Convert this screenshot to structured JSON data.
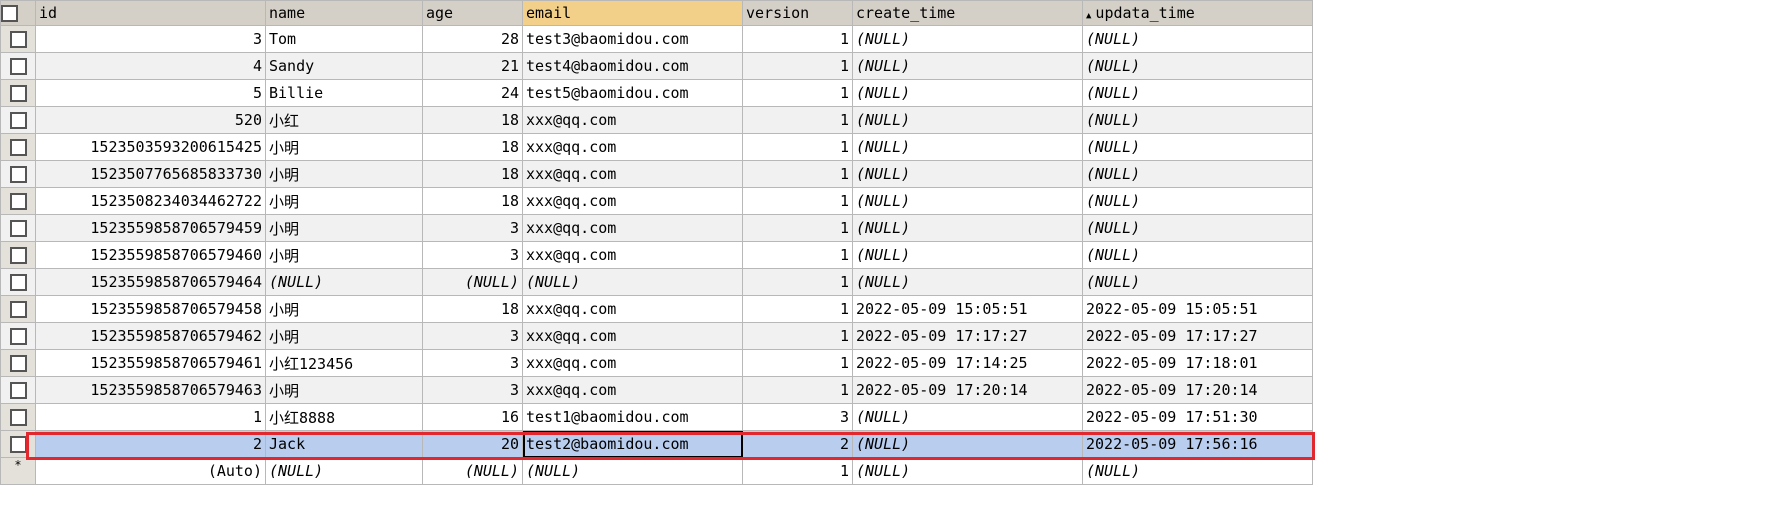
{
  "columns": [
    "id",
    "name",
    "age",
    "email",
    "version",
    "create_time",
    "updata_time"
  ],
  "sort_column_index": 6,
  "colors": {
    "header": "#d4d0c8",
    "sorted_header": "#f3d08a",
    "selected_row": "#b9cdee",
    "highlight": "#e0282e"
  },
  "rows": [
    {
      "id": "3",
      "name": "Tom",
      "age": "28",
      "email": "test3@baomidou.com",
      "version": "1",
      "create_time": "(NULL)",
      "updata_time": "(NULL)"
    },
    {
      "id": "4",
      "name": "Sandy",
      "age": "21",
      "email": "test4@baomidou.com",
      "version": "1",
      "create_time": "(NULL)",
      "updata_time": "(NULL)"
    },
    {
      "id": "5",
      "name": "Billie",
      "age": "24",
      "email": "test5@baomidou.com",
      "version": "1",
      "create_time": "(NULL)",
      "updata_time": "(NULL)"
    },
    {
      "id": "520",
      "name": "小红",
      "age": "18",
      "email": "xxx@qq.com",
      "version": "1",
      "create_time": "(NULL)",
      "updata_time": "(NULL)"
    },
    {
      "id": "1523503593200615425",
      "name": "小明",
      "age": "18",
      "email": "xxx@qq.com",
      "version": "1",
      "create_time": "(NULL)",
      "updata_time": "(NULL)"
    },
    {
      "id": "1523507765685833730",
      "name": "小明",
      "age": "18",
      "email": "xxx@qq.com",
      "version": "1",
      "create_time": "(NULL)",
      "updata_time": "(NULL)"
    },
    {
      "id": "1523508234034462722",
      "name": "小明",
      "age": "18",
      "email": "xxx@qq.com",
      "version": "1",
      "create_time": "(NULL)",
      "updata_time": "(NULL)"
    },
    {
      "id": "1523559858706579459",
      "name": "小明",
      "age": "3",
      "email": "xxx@qq.com",
      "version": "1",
      "create_time": "(NULL)",
      "updata_time": "(NULL)"
    },
    {
      "id": "1523559858706579460",
      "name": "小明",
      "age": "3",
      "email": "xxx@qq.com",
      "version": "1",
      "create_time": "(NULL)",
      "updata_time": "(NULL)"
    },
    {
      "id": "1523559858706579464",
      "name": "(NULL)",
      "age": "(NULL)",
      "email": "(NULL)",
      "version": "1",
      "create_time": "(NULL)",
      "updata_time": "(NULL)"
    },
    {
      "id": "1523559858706579458",
      "name": "小明",
      "age": "18",
      "email": "xxx@qq.com",
      "version": "1",
      "create_time": "2022-05-09 15:05:51",
      "updata_time": "2022-05-09 15:05:51"
    },
    {
      "id": "1523559858706579462",
      "name": "小明",
      "age": "3",
      "email": "xxx@qq.com",
      "version": "1",
      "create_time": "2022-05-09 17:17:27",
      "updata_time": "2022-05-09 17:17:27"
    },
    {
      "id": "1523559858706579461",
      "name": "小红123456",
      "age": "3",
      "email": "xxx@qq.com",
      "version": "1",
      "create_time": "2022-05-09 17:14:25",
      "updata_time": "2022-05-09 17:18:01"
    },
    {
      "id": "1523559858706579463",
      "name": "小明",
      "age": "3",
      "email": "xxx@qq.com",
      "version": "1",
      "create_time": "2022-05-09 17:20:14",
      "updata_time": "2022-05-09 17:20:14"
    },
    {
      "id": "1",
      "name": "小红8888",
      "age": "16",
      "email": "test1@baomidou.com",
      "version": "3",
      "create_time": "(NULL)",
      "updata_time": "2022-05-09 17:51:30"
    },
    {
      "id": "2",
      "name": "Jack",
      "age": "20",
      "email": "test2@baomidou.com",
      "version": "2",
      "create_time": "(NULL)",
      "updata_time": "2022-05-09 17:56:16",
      "selected": true
    }
  ],
  "new_row": {
    "marker": "*",
    "id": "(Auto)",
    "name": "(NULL)",
    "age": "(NULL)",
    "email": "(NULL)",
    "version": "1",
    "create_time": "(NULL)",
    "updata_time": "(NULL)"
  }
}
